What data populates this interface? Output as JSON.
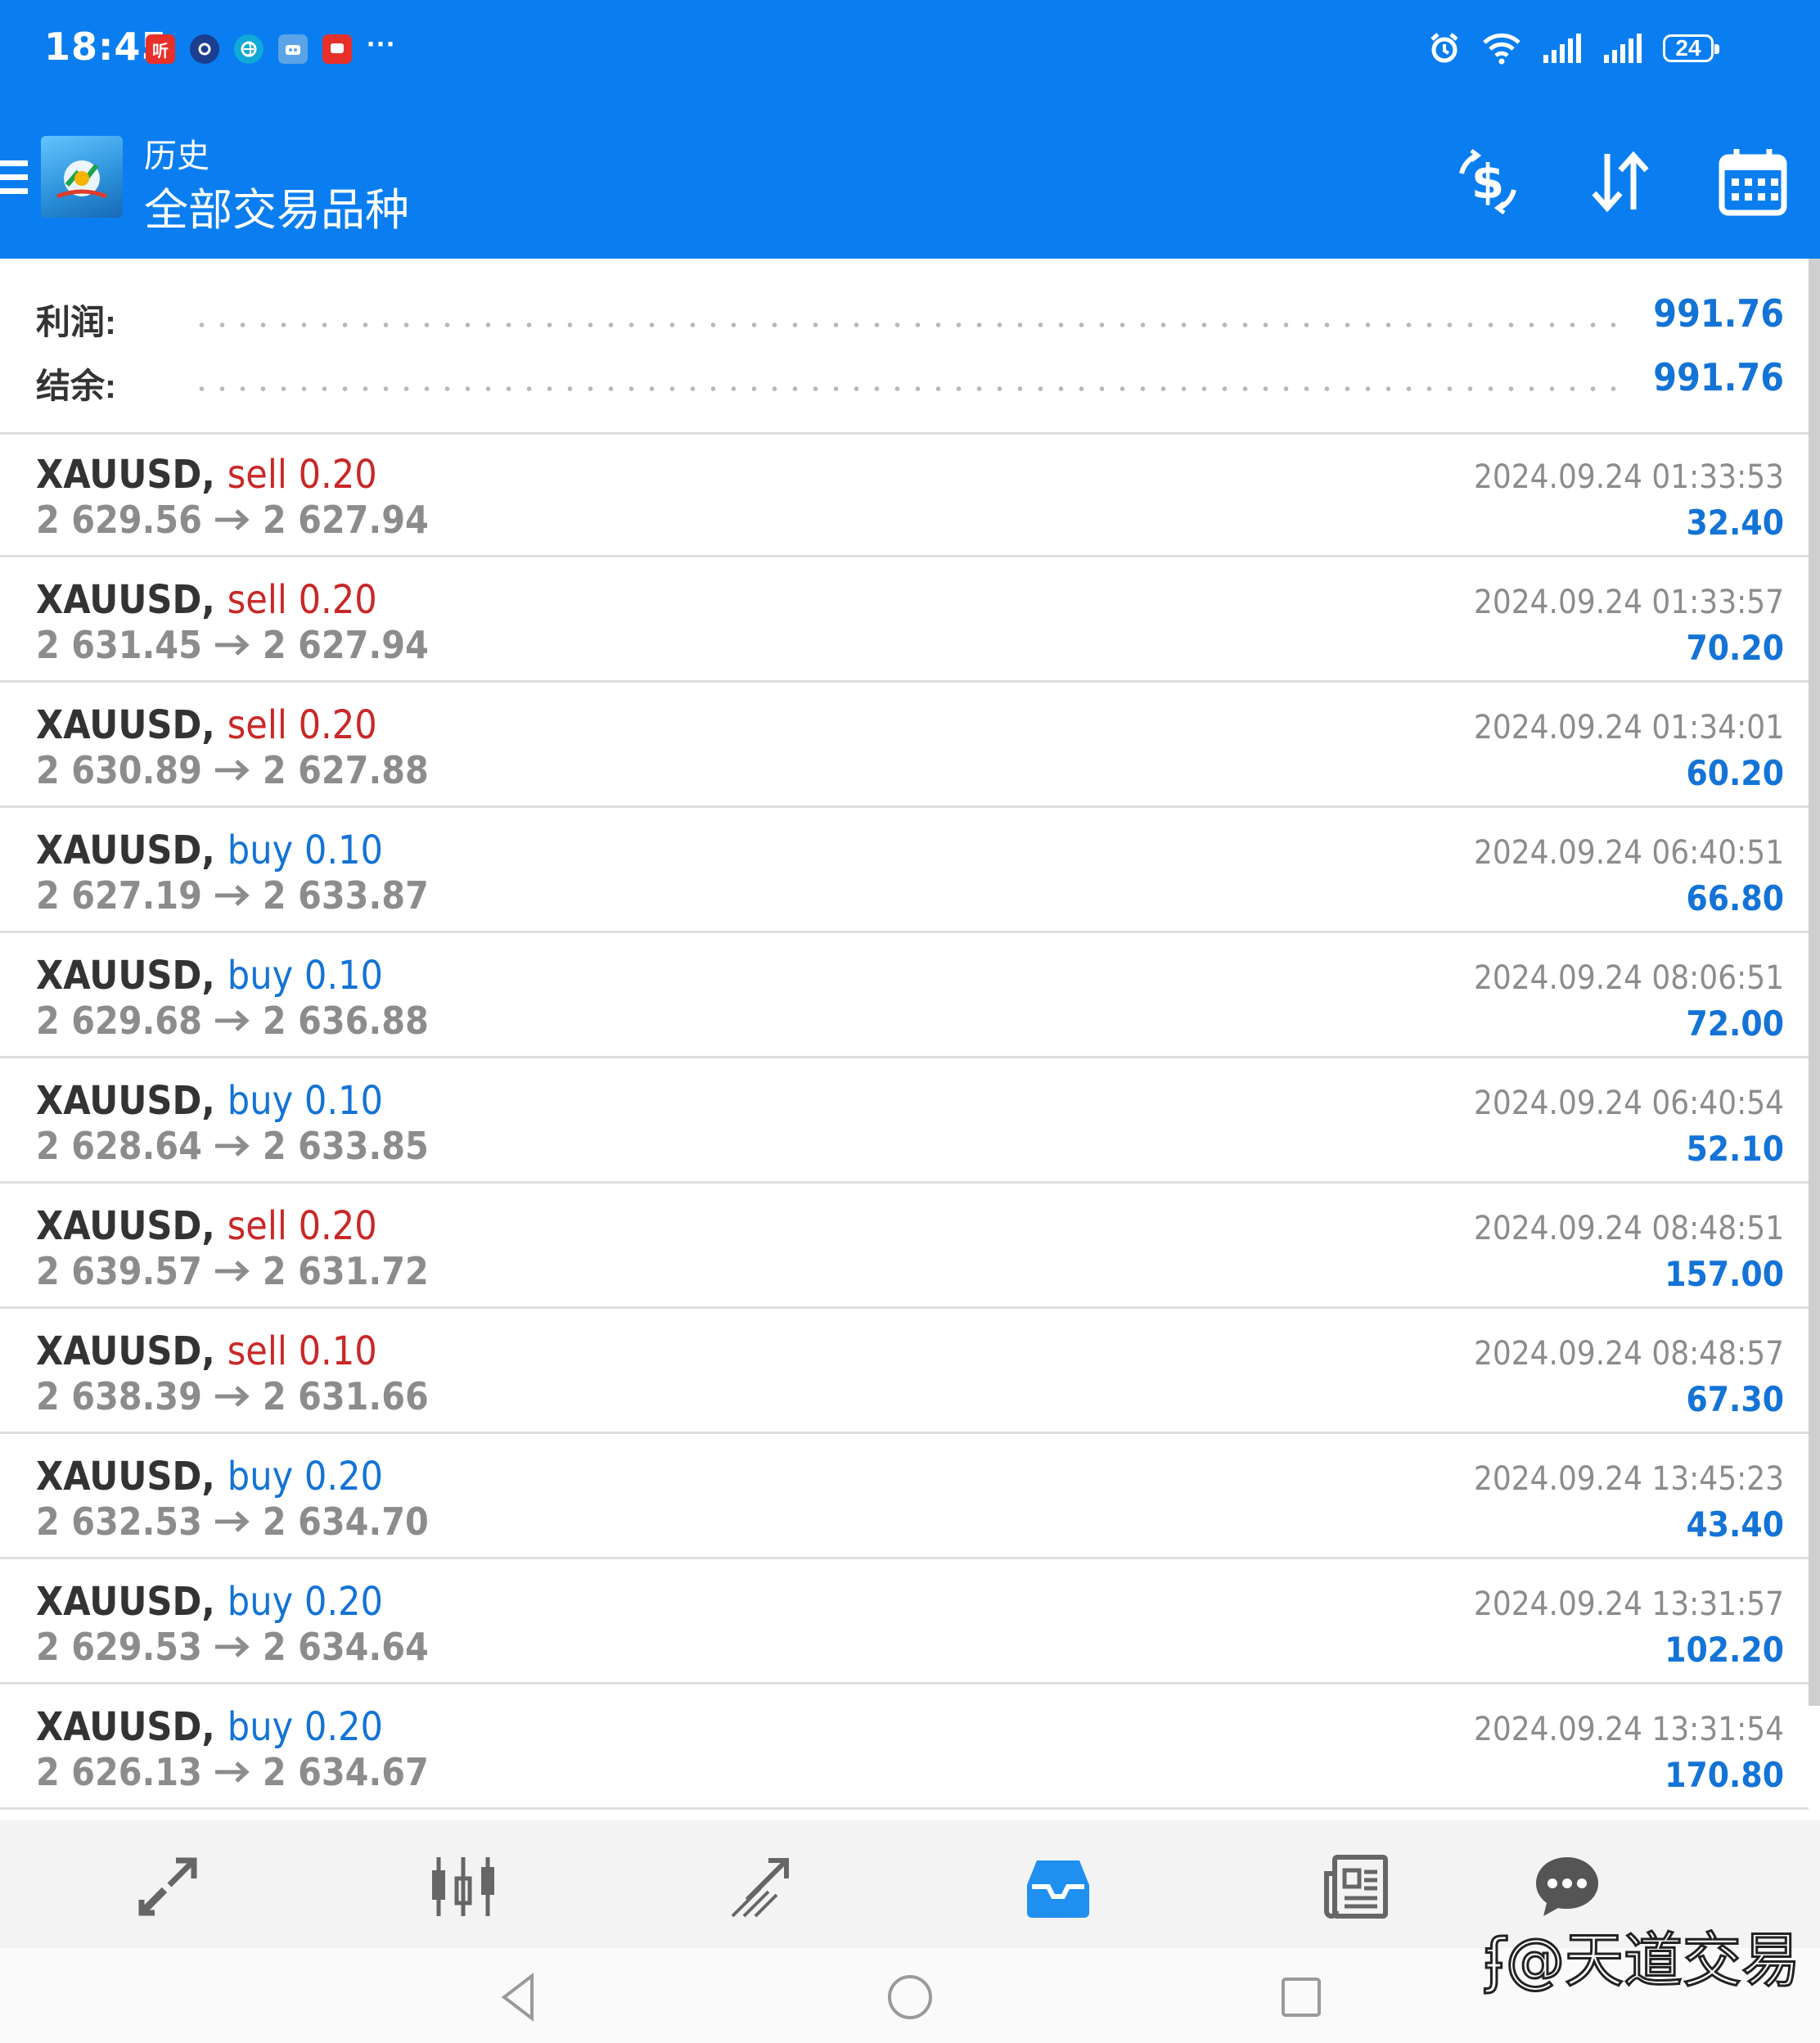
{
  "status_bar": {
    "time": "18:45",
    "notifications": [
      "听",
      "●",
      "◉",
      "R",
      "■"
    ],
    "more": "···",
    "battery": "24"
  },
  "toolbar": {
    "subtitle": "历史",
    "title": "全部交易品种"
  },
  "summary": {
    "profit_label": "利润:",
    "profit_value": "991.76",
    "balance_label": "结余:",
    "balance_value": "991.76"
  },
  "trades": [
    {
      "symbol": "XAUUSD",
      "side": "sell",
      "volume": "0.20",
      "open": "2 629.56",
      "close": "2 627.94",
      "time": "2024.09.24 01:33:53",
      "profit": "32.40"
    },
    {
      "symbol": "XAUUSD",
      "side": "sell",
      "volume": "0.20",
      "open": "2 631.45",
      "close": "2 627.94",
      "time": "2024.09.24 01:33:57",
      "profit": "70.20"
    },
    {
      "symbol": "XAUUSD",
      "side": "sell",
      "volume": "0.20",
      "open": "2 630.89",
      "close": "2 627.88",
      "time": "2024.09.24 01:34:01",
      "profit": "60.20"
    },
    {
      "symbol": "XAUUSD",
      "side": "buy",
      "volume": "0.10",
      "open": "2 627.19",
      "close": "2 633.87",
      "time": "2024.09.24 06:40:51",
      "profit": "66.80"
    },
    {
      "symbol": "XAUUSD",
      "side": "buy",
      "volume": "0.10",
      "open": "2 629.68",
      "close": "2 636.88",
      "time": "2024.09.24 08:06:51",
      "profit": "72.00"
    },
    {
      "symbol": "XAUUSD",
      "side": "buy",
      "volume": "0.10",
      "open": "2 628.64",
      "close": "2 633.85",
      "time": "2024.09.24 06:40:54",
      "profit": "52.10"
    },
    {
      "symbol": "XAUUSD",
      "side": "sell",
      "volume": "0.20",
      "open": "2 639.57",
      "close": "2 631.72",
      "time": "2024.09.24 08:48:51",
      "profit": "157.00"
    },
    {
      "symbol": "XAUUSD",
      "side": "sell",
      "volume": "0.10",
      "open": "2 638.39",
      "close": "2 631.66",
      "time": "2024.09.24 08:48:57",
      "profit": "67.30"
    },
    {
      "symbol": "XAUUSD",
      "side": "buy",
      "volume": "0.20",
      "open": "2 632.53",
      "close": "2 634.70",
      "time": "2024.09.24 13:45:23",
      "profit": "43.40"
    },
    {
      "symbol": "XAUUSD",
      "side": "buy",
      "volume": "0.20",
      "open": "2 629.53",
      "close": "2 634.64",
      "time": "2024.09.24 13:31:57",
      "profit": "102.20"
    },
    {
      "symbol": "XAUUSD",
      "side": "buy",
      "volume": "0.20",
      "open": "2 626.13",
      "close": "2 634.67",
      "time": "2024.09.24 13:31:54",
      "profit": "170.80"
    }
  ],
  "bottom_nav": {
    "items": [
      "quotes-icon",
      "chart-icon",
      "trade-icon",
      "history-icon",
      "news-icon",
      "chat-icon"
    ],
    "active": "history-icon"
  },
  "watermark": "ʄ@天道交易",
  "colors": {
    "header_bg": "#0a7ef0",
    "sell": "#c92828",
    "buy": "#1473d6",
    "profit": "#1473d6",
    "muted": "#8c8c8c"
  }
}
